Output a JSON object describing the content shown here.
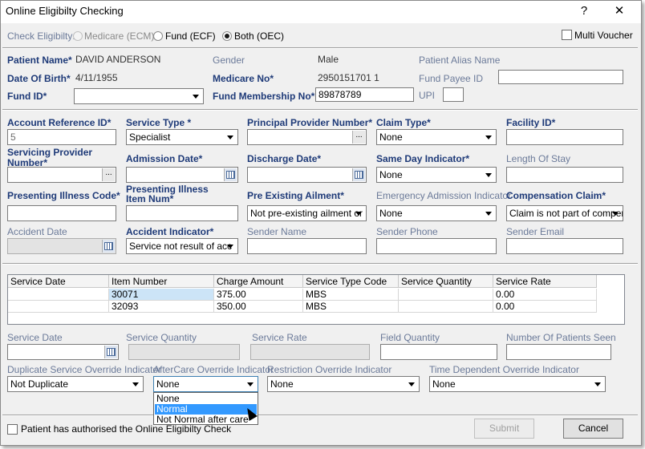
{
  "window": {
    "title": "Online Eligibilty Checking",
    "help_label": "?",
    "close_label": "✕"
  },
  "check": {
    "label": "Check Eligibilty:",
    "options": [
      "Medicare (ECM)",
      "Fund (ECF)",
      "Both (OEC)"
    ],
    "selected": "Both (OEC)",
    "multi_voucher_label": "Multi Voucher"
  },
  "patient": {
    "name_label": "Patient Name*",
    "name_value": "DAVID  ANDERSON",
    "gender_label": "Gender",
    "gender_value": "Male",
    "alias_label": "Patient Alias Name",
    "dob_label": "Date Of Birth*",
    "dob_value": "4/11/1955",
    "medicare_label": "Medicare No*",
    "medicare_value": "2950151701 1",
    "fund_payee_label": "Fund Payee ID",
    "fund_payee_value": "",
    "fund_id_label": "Fund ID*",
    "fund_id_value": "",
    "membership_label": "Fund Membership No*",
    "membership_value": "89878789",
    "upi_label": "UPI",
    "upi_value": ""
  },
  "claim": {
    "account_ref_label": "Account Reference ID*",
    "account_ref_value": "5",
    "service_type_label": "Service Type *",
    "service_type_value": "Specialist",
    "principal_provider_label": "Principal Provider Number*",
    "claim_type_label": "Claim Type*",
    "claim_type_value": "None",
    "facility_label": "Facility ID*",
    "servicing_provider_label": "Servicing Provider Number*",
    "admission_label": "Admission Date*",
    "discharge_label": "Discharge Date*",
    "same_day_label": "Same Day Indicator*",
    "same_day_value": "None",
    "length_stay_label": "Length Of Stay",
    "illness_code_label": "Presenting Illness Code*",
    "illness_item_label": "Presenting Illness Item Num*",
    "pre_existing_label": "Pre Existing Ailment*",
    "pre_existing_value": "Not pre-existing ailment or i",
    "emergency_label": "Emergency Admission Indicator",
    "emergency_value": "None",
    "compensation_label": "Compensation Claim*",
    "compensation_value": "Claim is not part of compen",
    "accident_date_label": "Accident Date",
    "accident_ind_label": "Accident Indicator*",
    "accident_ind_value": "Service not result of acc",
    "sender_name_label": "Sender Name",
    "sender_phone_label": "Sender Phone",
    "sender_email_label": "Sender Email"
  },
  "services_table": {
    "columns": [
      "Service Date",
      "Item Number",
      "Charge Amount",
      "Service Type Code",
      "Service Quantity",
      "Service Rate"
    ],
    "rows": [
      [
        "",
        "30071",
        "375.00",
        "MBS",
        "",
        "0.00"
      ],
      [
        "",
        "32093",
        "350.00",
        "MBS",
        "",
        "0.00"
      ]
    ]
  },
  "service_detail": {
    "service_date_label": "Service Date",
    "service_qty_label": "Service Quantity",
    "service_rate_label": "Service Rate",
    "field_qty_label": "Field Quantity",
    "patients_seen_label": "Number Of Patients Seen",
    "duplicate_label": "Duplicate Service Override Indicator",
    "duplicate_value": "Not Duplicate",
    "aftercare_label": "AfterCare Override Indicator",
    "aftercare_value": "None",
    "restriction_label": "Restriction Override Indicator",
    "restriction_value": "None",
    "time_dep_label": "Time Dependent Override Indicator",
    "time_dep_value": "None",
    "aftercare_options": [
      "None",
      "Normal",
      "Not Normal after care"
    ],
    "aftercare_highlighted": "Normal"
  },
  "footer": {
    "authorised_label": "Patient has authorised the Online Eligibilty Check",
    "submit_label": "Submit",
    "cancel_label": "Cancel"
  }
}
